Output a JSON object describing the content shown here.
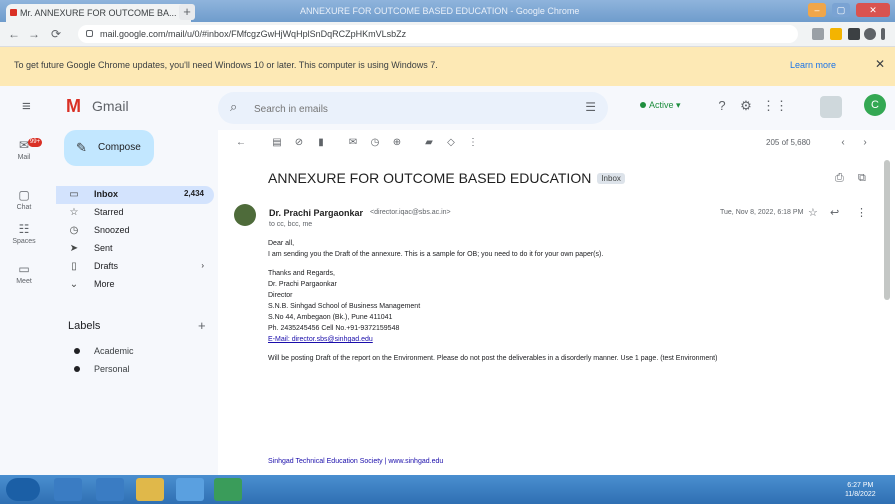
{
  "browser": {
    "tab_title": "Mr. ANNEXURE FOR OUTCOME BA...",
    "tab_close": "×",
    "new_tab": "+",
    "title_text": "ANNEXURE FOR OUTCOME BASED EDUCATION - Google Chrome",
    "url": "mail.google.com/mail/u/0/#inbox/FMfcgzGwHjWqHplSnDqRCZpHKmVLsbZz",
    "back": "←",
    "forward": "→",
    "reload": "⟳"
  },
  "infobar": {
    "text": "To get future Google Chrome updates, you'll need Windows 10 or later. This computer is using Windows 7.",
    "learn_more": "Learn more",
    "close": "✕"
  },
  "gmail": {
    "app_name": "Gmail",
    "logo": "M",
    "search_placeholder": "Search in emails",
    "status": "Active",
    "avatar_letter": "C"
  },
  "rail": [
    {
      "label": "Mail",
      "icon": "✉",
      "badge": "99+"
    },
    {
      "label": "Chat",
      "icon": "▢"
    },
    {
      "label": "Spaces",
      "icon": "☷"
    },
    {
      "label": "Meet",
      "icon": "▭"
    }
  ],
  "sidebar": {
    "compose": "Compose",
    "items": [
      {
        "label": "Inbox",
        "count": "2,434",
        "icon": "▭"
      },
      {
        "label": "Starred",
        "count": "",
        "icon": "☆"
      },
      {
        "label": "Snoozed",
        "count": "",
        "icon": "◷"
      },
      {
        "label": "Sent",
        "count": "",
        "icon": "➤"
      },
      {
        "label": "Drafts",
        "count": "",
        "icon": "▯"
      },
      {
        "label": "More",
        "count": "",
        "icon": "⌄"
      }
    ],
    "labels_heading": "Labels",
    "labels_add": "+",
    "labels": [
      "Academic",
      "Personal"
    ]
  },
  "toolbar": {
    "page_count": "205 of 5,680"
  },
  "email": {
    "subject": "ANNEXURE FOR OUTCOME BASED EDUCATION",
    "tag": "Inbox",
    "sender_name": "Dr. Prachi Pargaonkar",
    "sender_email": "<director.iqac@sbs.ac.in>",
    "to": "to cc, bcc, me",
    "date": "Tue, Nov 8, 2022, 6:18 PM",
    "body_lines": [
      "Dear all,",
      "I am sending you the Draft of the annexure. This is a sample for OB; you need to do it for your own paper(s).",
      "",
      "Thanks and Regards,",
      "Dr. Prachi Pargaonkar",
      "Director",
      "S.N.B. Sinhgad School of Business Management",
      "S.No 44, Ambegaon (Bk.), Pune 411041",
      "Ph. 2435245456 Cell No.+91-9372159548",
      "E-Mail: director.sbs@sinhgad.edu",
      "",
      "Will be posting Draft of the report on the Environment. Please do not post the deliverables in a disorderly manner. Use 1 page. (test Environment)"
    ],
    "footer": "Sinhgad Technical Education Society | www.sinhgad.edu"
  },
  "taskbar": {
    "clock_time": "6:27 PM",
    "clock_date": "11/8/2022"
  }
}
